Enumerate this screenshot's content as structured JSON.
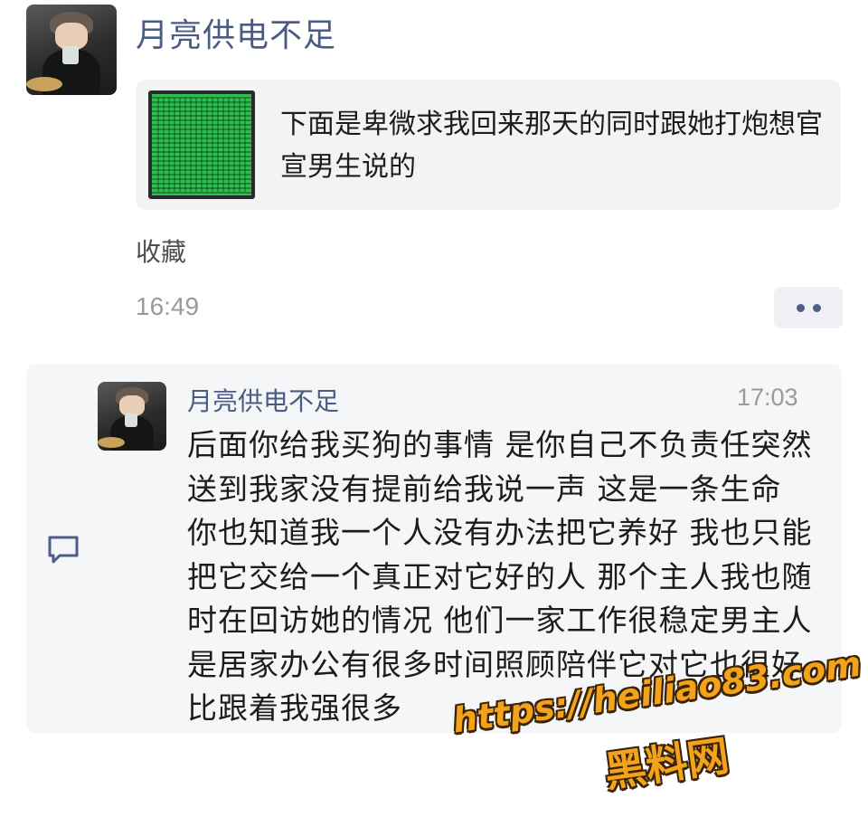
{
  "post": {
    "author": "月亮供电不足",
    "share_text": "下面是卑微求我回来那天的同时跟她打炮想官宣男生说的",
    "favorite_label": "收藏",
    "time": "16:49"
  },
  "comment": {
    "author": "月亮供电不足",
    "time": "17:03",
    "text": "后面你给我买狗的事情 是你自己不负责任突然送到我家没有提前给我说一声 这是一条生命 你也知道我一个人没有办法把它养好 我也只能把它交给一个真正对它好的人 那个主人我也随时在回访她的情况 他们一家工作很稳定男主人是居家办公有很多时间照顾陪伴它对它也很好 比跟着我强很多"
  },
  "watermark": {
    "url": "https://heiliao83.com",
    "name": "黑料网"
  },
  "colors": {
    "author_name": "#4a5c83",
    "accent_dots": "#4d5f86",
    "card_bg": "#f2f3f5",
    "watermark": "#f3a21b"
  },
  "icons": {
    "more": "more-dots-icon",
    "comment": "comment-bubble-icon"
  }
}
